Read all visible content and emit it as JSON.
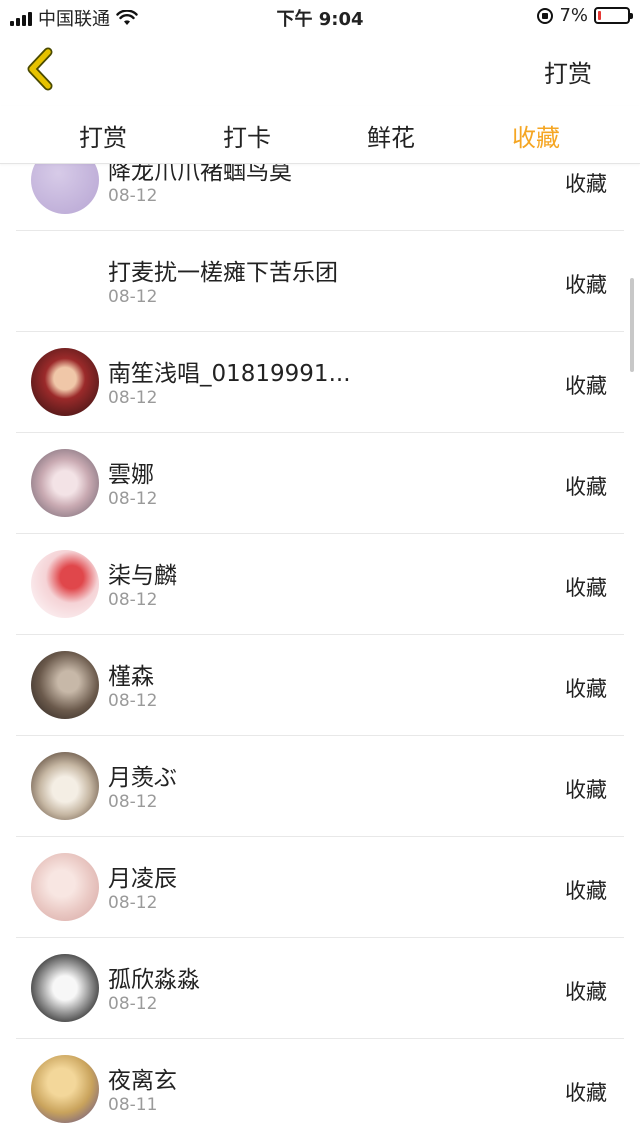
{
  "status_bar": {
    "carrier": "中国联通",
    "time": "下午 9:04",
    "battery_percent": "7%",
    "battery_level": 0.07,
    "icons": [
      "signal-icon",
      "wifi-icon",
      "rotation-lock-icon",
      "battery-icon"
    ]
  },
  "nav": {
    "back_icon": "chevron-left-icon",
    "action_label": "打赏"
  },
  "tabs": [
    {
      "label": "打赏",
      "active": false
    },
    {
      "label": "打卡",
      "active": false
    },
    {
      "label": "鲜花",
      "active": false
    },
    {
      "label": "收藏",
      "active": true
    }
  ],
  "colors": {
    "accent": "#f5a623",
    "back_arrow": "#e6c200",
    "date_text": "#9a9a9a"
  },
  "list": [
    {
      "name": "降龙爪爪褚蝈鸟莫",
      "date": "08-12",
      "status": "收藏",
      "avatar": "purple"
    },
    {
      "name": "打麦扰一槎瘫下苦乐团",
      "date": "08-12",
      "status": "收藏",
      "avatar": "none"
    },
    {
      "name": "南笙浅唱_01819991...",
      "date": "08-12",
      "status": "收藏",
      "avatar": "red"
    },
    {
      "name": "雲娜",
      "date": "08-12",
      "status": "收藏",
      "avatar": "pinkgray"
    },
    {
      "name": "柒与麟",
      "date": "08-12",
      "status": "收藏",
      "avatar": "pinkred"
    },
    {
      "name": "槿森",
      "date": "08-12",
      "status": "收藏",
      "avatar": "dark"
    },
    {
      "name": "月羡ぶ",
      "date": "08-12",
      "status": "收藏",
      "avatar": "cream"
    },
    {
      "name": "月凌辰",
      "date": "08-12",
      "status": "收藏",
      "avatar": "peach"
    },
    {
      "name": "孤欣淼淼",
      "date": "08-12",
      "status": "收藏",
      "avatar": "mono"
    },
    {
      "name": "夜离玄",
      "date": "08-11",
      "status": "收藏",
      "avatar": "gold"
    }
  ]
}
